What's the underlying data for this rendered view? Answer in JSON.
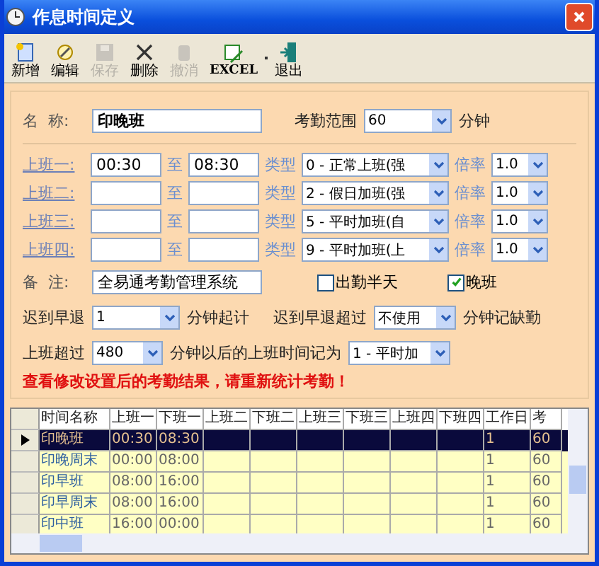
{
  "window": {
    "title": "作息时间定义"
  },
  "toolbar": [
    {
      "kind": "new",
      "label": "新增",
      "disabled": false
    },
    {
      "kind": "edit",
      "label": "编辑",
      "disabled": false
    },
    {
      "kind": "save",
      "label": "保存",
      "disabled": true
    },
    {
      "kind": "delete",
      "label": "删除",
      "disabled": false
    },
    {
      "kind": "cancel",
      "label": "撤消",
      "disabled": true
    },
    {
      "kind": "excel",
      "label": "EXCEL",
      "disabled": false
    },
    {
      "kind": "exit",
      "label": "退出",
      "disabled": false
    }
  ],
  "name_row": {
    "label": "名  称:",
    "value": "印晚班",
    "range_label": "考勤范围",
    "range_value": "60",
    "range_unit": "分钟"
  },
  "shifts": [
    {
      "label": "上班一:",
      "start": "00:30",
      "to_label": "至",
      "end": "08:30",
      "type_label": "类型",
      "type": "0 - 正常上班(强",
      "rate_label": "倍率",
      "rate": "1.0"
    },
    {
      "label": "上班二:",
      "to_label": "至",
      "type_label": "类型",
      "type": "2 - 假日加班(强",
      "rate_label": "倍率",
      "rate": "1.0"
    },
    {
      "label": "上班三:",
      "to_label": "至",
      "type_label": "类型",
      "type": "5 - 平时加班(自",
      "rate_label": "倍率",
      "rate": "1.0"
    },
    {
      "label": "上班四:",
      "to_label": "至",
      "type_label": "类型",
      "type": "9 - 平时加班(上",
      "rate_label": "倍率",
      "rate": "1.0"
    }
  ],
  "remark": {
    "label": "备  注:",
    "value": "全易通考勤管理系统"
  },
  "checkboxes": [
    {
      "label": "出勤半天",
      "checked": false
    },
    {
      "label": "晚班",
      "checked": true
    }
  ],
  "late_row": {
    "label": "迟到早退",
    "value": "1",
    "unit": "分钟起计",
    "over_label": "迟到早退超过",
    "over_value": "不使用",
    "over_unit": "分钟记缺勤"
  },
  "overtime_row": {
    "label": "上班超过",
    "value": "480",
    "unit": "分钟以后的上班时间记为",
    "type": "1 - 平时加"
  },
  "notice": "查看修改设置后的考勤结果，请重新统计考勤！",
  "table": {
    "columns": [
      "时间名称",
      "上班一",
      "下班一",
      "上班二",
      "下班二",
      "上班三",
      "下班三",
      "上班四",
      "下班四",
      "工作日",
      "考"
    ],
    "rows": [
      {
        "selected": true,
        "cells": [
          "印晚班",
          "00:30",
          "08:30",
          "",
          "",
          "",
          "",
          "",
          "",
          "1",
          "60"
        ]
      },
      {
        "selected": false,
        "cells": [
          "印晚周末",
          "00:00",
          "08:00",
          "",
          "",
          "",
          "",
          "",
          "",
          "1",
          "60"
        ]
      },
      {
        "selected": false,
        "cells": [
          "印早班",
          "08:00",
          "16:00",
          "",
          "",
          "",
          "",
          "",
          "",
          "1",
          "60"
        ]
      },
      {
        "selected": false,
        "cells": [
          "印早周末",
          "08:00",
          "16:00",
          "",
          "",
          "",
          "",
          "",
          "",
          "1",
          "60"
        ]
      },
      {
        "selected": false,
        "cells": [
          "印中班",
          "16:00",
          "00:00",
          "",
          "",
          "",
          "",
          "",
          "",
          "1",
          "60"
        ]
      }
    ]
  }
}
